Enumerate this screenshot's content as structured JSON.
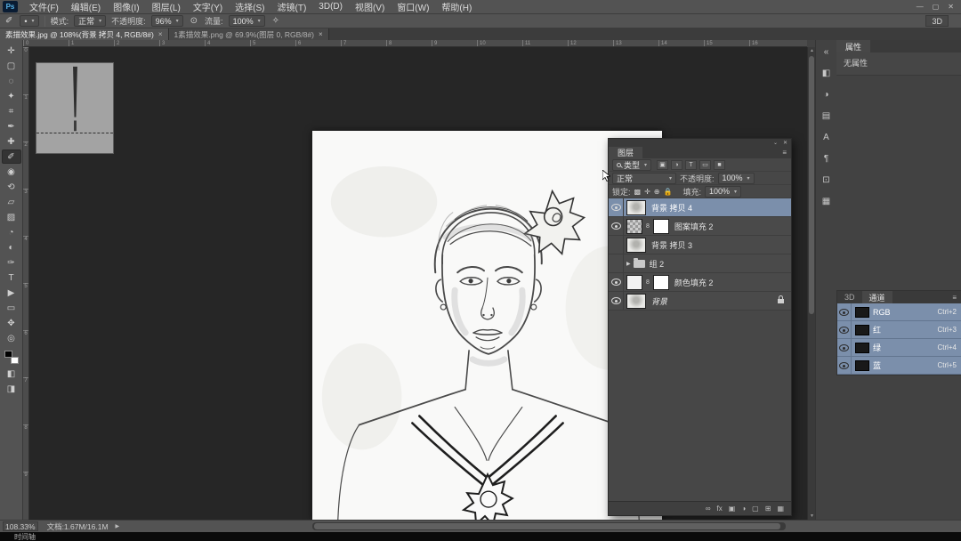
{
  "colors": {
    "selection_blue": "#7b8fab",
    "canvas_bg": "#262626",
    "panel_bg": "#474747"
  },
  "window": {
    "logo_text": "Ps",
    "minimize": "—",
    "restore": "▢",
    "close": "✕",
    "workspace_label": "3D"
  },
  "menubar": {
    "items": [
      "文件(F)",
      "编辑(E)",
      "图像(I)",
      "图层(L)",
      "文字(Y)",
      "选择(S)",
      "滤镜(T)",
      "3D(D)",
      "视图(V)",
      "窗口(W)",
      "帮助(H)"
    ]
  },
  "options_bar": {
    "tool_icon": "✐",
    "mode_label": "模式:",
    "mode_value": "正常",
    "opacity_label": "不透明度:",
    "opacity_value": "96%",
    "flow_label": "流量:",
    "flow_value": "100%",
    "pressure_icon": "⊙",
    "airbrush_icon": "✧"
  },
  "tabs": [
    {
      "label": "素描效果.jpg @ 108%(背景 拷贝 4, RGB/8#)",
      "close": "×"
    },
    {
      "label": "1素描效果.png @ 69.9%(图层 0, RGB/8#)",
      "close": "×"
    }
  ],
  "tools": [
    {
      "name": "tool-move",
      "glyph": "✛"
    },
    {
      "name": "tool-marquee",
      "glyph": "▢"
    },
    {
      "name": "tool-lasso",
      "glyph": "◌"
    },
    {
      "name": "tool-quick-select",
      "glyph": "✦"
    },
    {
      "name": "tool-crop",
      "glyph": "⌗"
    },
    {
      "name": "tool-eyedropper",
      "glyph": "✒"
    },
    {
      "name": "tool-healing-brush",
      "glyph": "✚"
    },
    {
      "name": "tool-brush",
      "glyph": "✐",
      "active": "true"
    },
    {
      "name": "tool-clone-stamp",
      "glyph": "◉"
    },
    {
      "name": "tool-history-brush",
      "glyph": "⟲"
    },
    {
      "name": "tool-eraser",
      "glyph": "▱"
    },
    {
      "name": "tool-gradient",
      "glyph": "▨"
    },
    {
      "name": "tool-blur",
      "glyph": "◔"
    },
    {
      "name": "tool-dodge",
      "glyph": "◐"
    },
    {
      "name": "tool-pen",
      "glyph": "✑"
    },
    {
      "name": "tool-type",
      "glyph": "T"
    },
    {
      "name": "tool-path-select",
      "glyph": "▶"
    },
    {
      "name": "tool-shape",
      "glyph": "▭"
    },
    {
      "name": "tool-hand",
      "glyph": "✥"
    },
    {
      "name": "tool-zoom",
      "glyph": "◎"
    }
  ],
  "tool_extras": [
    {
      "name": "quick-mask-icon",
      "glyph": "◧"
    },
    {
      "name": "screen-mode-icon",
      "glyph": "◨"
    }
  ],
  "rulers": {
    "top": [
      "0",
      "1",
      "2",
      "3",
      "4",
      "5",
      "6",
      "7",
      "8",
      "9",
      "10",
      "11",
      "12",
      "13",
      "14",
      "15",
      "16"
    ],
    "left": [
      "0",
      "1",
      "2",
      "3",
      "4",
      "5",
      "6",
      "7",
      "8",
      "9"
    ]
  },
  "layers_panel": {
    "title": "图层",
    "collapse_glyph": "⌄",
    "close_glyph": "✕",
    "menu_glyph": "≡",
    "search_label": "类型",
    "filter_icons": [
      {
        "name": "filter-pixel-layers-icon",
        "glyph": "▣"
      },
      {
        "name": "filter-adjustment-layers-icon",
        "glyph": "◑"
      },
      {
        "name": "filter-type-layers-icon",
        "glyph": "T"
      },
      {
        "name": "filter-shape-layers-icon",
        "glyph": "▭"
      },
      {
        "name": "filter-smart-objects-icon",
        "glyph": "■"
      }
    ],
    "blend_mode": "正常",
    "opacity_label": "不透明度:",
    "opacity_value": "100%",
    "lock_label": "锁定:",
    "lock_icons": [
      {
        "name": "lock-transparency-icon",
        "glyph": "▩"
      },
      {
        "name": "lock-pixels-icon",
        "glyph": "✛"
      },
      {
        "name": "lock-position-icon",
        "glyph": "⊕"
      },
      {
        "name": "lock-all-icon",
        "glyph": "🔒"
      }
    ],
    "fill_label": "填充:",
    "fill_value": "100%",
    "layers": [
      {
        "name": "背景 拷贝 4",
        "type": "image",
        "visible": true,
        "selected": true
      },
      {
        "name": "图案填充 2",
        "type": "pattern-fill",
        "visible": true,
        "selected": false
      },
      {
        "name": "背景 拷贝 3",
        "type": "image",
        "visible": false,
        "selected": false
      },
      {
        "name": "组 2",
        "type": "group",
        "visible": false,
        "selected": false
      },
      {
        "name": "颜色填充 2",
        "type": "color-fill",
        "visible": true,
        "selected": false
      },
      {
        "name": "背景",
        "type": "background",
        "visible": true,
        "selected": false,
        "locked": true
      }
    ],
    "bottom_icons": [
      {
        "name": "link-layers-icon",
        "glyph": "∞"
      },
      {
        "name": "layer-effects-icon",
        "glyph": "fx"
      },
      {
        "name": "add-layer-mask-icon",
        "glyph": "▣"
      },
      {
        "name": "new-adjustment-layer-icon",
        "glyph": "◑"
      },
      {
        "name": "new-group-icon",
        "glyph": "▢"
      },
      {
        "name": "new-layer-icon",
        "glyph": "⊞"
      },
      {
        "name": "delete-layer-icon",
        "glyph": "▦"
      }
    ]
  },
  "properties_panel": {
    "title": "属性",
    "empty_text": "无属性"
  },
  "channels_panel": {
    "tab_inactive": "3D",
    "title": "通道",
    "menu_glyph": "≡",
    "channels": [
      {
        "name": "RGB",
        "shortcut": "Ctrl+2"
      },
      {
        "name": "红",
        "shortcut": "Ctrl+3"
      },
      {
        "name": "绿",
        "shortcut": "Ctrl+4"
      },
      {
        "name": "蓝",
        "shortcut": "Ctrl+5"
      }
    ]
  },
  "right_strip": [
    {
      "name": "collapse-panels-icon",
      "glyph": "«"
    },
    {
      "name": "color-panel-icon",
      "glyph": "◧"
    },
    {
      "name": "adjustments-panel-icon",
      "glyph": "◑"
    },
    {
      "name": "styles-panel-icon",
      "glyph": "▤"
    },
    {
      "name": "character-panel-icon",
      "glyph": "A"
    },
    {
      "name": "paragraph-panel-icon",
      "glyph": "¶"
    },
    {
      "name": "clone-source-panel-icon",
      "glyph": "⊡"
    },
    {
      "name": "histogram-panel-icon",
      "glyph": "▦"
    }
  ],
  "status_bar": {
    "zoom": "108.33%",
    "doc_info": "文档:1.67M/16.1M",
    "menu_arrow": "▶"
  },
  "bottom_bar": {
    "timeline_label": "时间轴"
  }
}
